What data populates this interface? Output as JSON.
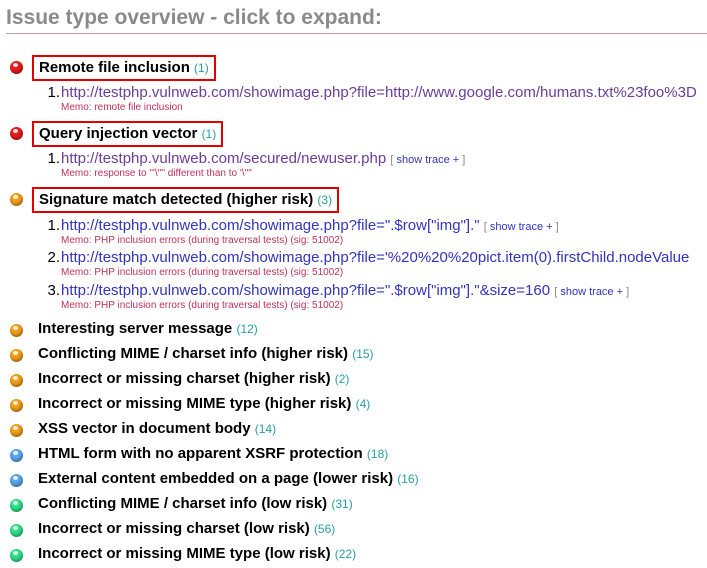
{
  "title": "Issue type overview - click to expand:",
  "trace_link": "show trace +",
  "issues": [
    {
      "label": "Remote file inclusion",
      "count": "(1)",
      "severity": "red",
      "highlighted": true,
      "items": [
        {
          "num": "1.",
          "url": "http://testphp.vulnweb.com/showimage.php?file=http://www.google.com/humans.txt%23foo%3D",
          "memo": "Memo: remote file inclusion",
          "trace": false
        }
      ]
    },
    {
      "label": "Query injection vector",
      "count": "(1)",
      "severity": "red",
      "highlighted": true,
      "items": [
        {
          "num": "1.",
          "url": "http://testphp.vulnweb.com/secured/newuser.php",
          "memo": "Memo: response to '\"\\'\"' different than to '\\'\"'",
          "trace": true
        }
      ]
    },
    {
      "label": "Signature match detected (higher risk)",
      "count": "(3)",
      "severity": "orange",
      "highlighted": true,
      "items": [
        {
          "num": "1.",
          "url": "http://testphp.vulnweb.com/showimage.php?file=\".$row[\"img\"].\"",
          "memo": "Memo: PHP inclusion errors (during traversal tests) (sig: 51002)",
          "trace": true
        },
        {
          "num": "2.",
          "url": "http://testphp.vulnweb.com/showimage.php?file='%20%20%20pict.item(0).firstChild.nodeValue",
          "memo": "Memo: PHP inclusion errors (during traversal tests) (sig: 51002)",
          "trace": false
        },
        {
          "num": "3.",
          "url": "http://testphp.vulnweb.com/showimage.php?file=\".$row[\"img\"].\"&size=160",
          "memo": "Memo: PHP inclusion errors (during traversal tests) (sig: 51002)",
          "trace": true
        }
      ]
    },
    {
      "label": "Interesting server message",
      "count": "(12)",
      "severity": "orange",
      "highlighted": false
    },
    {
      "label": "Conflicting MIME / charset info (higher risk)",
      "count": "(15)",
      "severity": "orange",
      "highlighted": false
    },
    {
      "label": "Incorrect or missing charset (higher risk)",
      "count": "(2)",
      "severity": "orange",
      "highlighted": false
    },
    {
      "label": "Incorrect or missing MIME type (higher risk)",
      "count": "(4)",
      "severity": "orange",
      "highlighted": false
    },
    {
      "label": "XSS vector in document body",
      "count": "(14)",
      "severity": "orange",
      "highlighted": false
    },
    {
      "label": "HTML form with no apparent XSRF protection",
      "count": "(18)",
      "severity": "blue",
      "highlighted": false
    },
    {
      "label": "External content embedded on a page (lower risk)",
      "count": "(16)",
      "severity": "blue",
      "highlighted": false
    },
    {
      "label": "Conflicting MIME / charset info (low risk)",
      "count": "(31)",
      "severity": "green",
      "highlighted": false
    },
    {
      "label": "Incorrect or missing charset (low risk)",
      "count": "(56)",
      "severity": "green",
      "highlighted": false
    },
    {
      "label": "Incorrect or missing MIME type (low risk)",
      "count": "(22)",
      "severity": "green",
      "highlighted": false
    }
  ]
}
